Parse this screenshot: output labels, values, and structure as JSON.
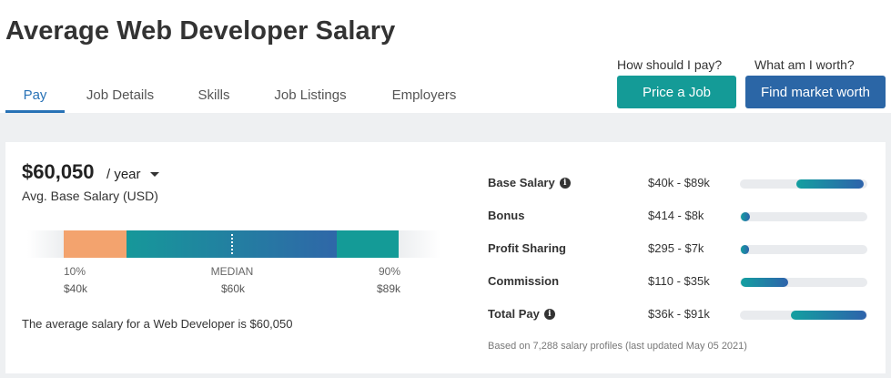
{
  "header": {
    "title": "Average Web Developer Salary"
  },
  "tabs": [
    {
      "label": "Pay",
      "active": true
    },
    {
      "label": "Job Details",
      "active": false
    },
    {
      "label": "Skills",
      "active": false
    },
    {
      "label": "Job Listings",
      "active": false
    },
    {
      "label": "Employers",
      "active": false
    }
  ],
  "cta": {
    "pay_question": "How should I pay?",
    "price_button": "Price a Job",
    "worth_question": "What am I worth?",
    "market_button": "Find market worth"
  },
  "summary": {
    "amount": "$60,050",
    "period": "/ year",
    "subtitle": "Avg. Base Salary (USD)",
    "sentence": "The average salary for a Web Developer is $60,050"
  },
  "range_bar": {
    "p10_label": "10%",
    "median_label": "MEDIAN",
    "p90_label": "90%",
    "p10_value": "$40k",
    "median_value": "$60k",
    "p90_value": "$89k"
  },
  "compensation": [
    {
      "label": "Base Salary",
      "info_icon": true,
      "range": "$40k - $89k",
      "fill_start": 0.44,
      "fill_end": 0.97
    },
    {
      "label": "Bonus",
      "info_icon": false,
      "range": "$414 - $8k",
      "fill_start": 0.01,
      "fill_end": 0.08
    },
    {
      "label": "Profit Sharing",
      "info_icon": false,
      "range": "$295 - $7k",
      "fill_start": 0.01,
      "fill_end": 0.07
    },
    {
      "label": "Commission",
      "info_icon": false,
      "range": "$110 - $35k",
      "fill_start": 0.01,
      "fill_end": 0.38
    },
    {
      "label": "Total Pay",
      "info_icon": true,
      "range": "$36k - $91k",
      "fill_start": 0.4,
      "fill_end": 0.99
    }
  ],
  "footnote": "Based on 7,288 salary profiles (last updated May 05 2021)",
  "colors": {
    "accent_blue": "#2872b6",
    "teal": "#149b97",
    "navy": "#2b66a6",
    "orange": "#f3a36e"
  }
}
